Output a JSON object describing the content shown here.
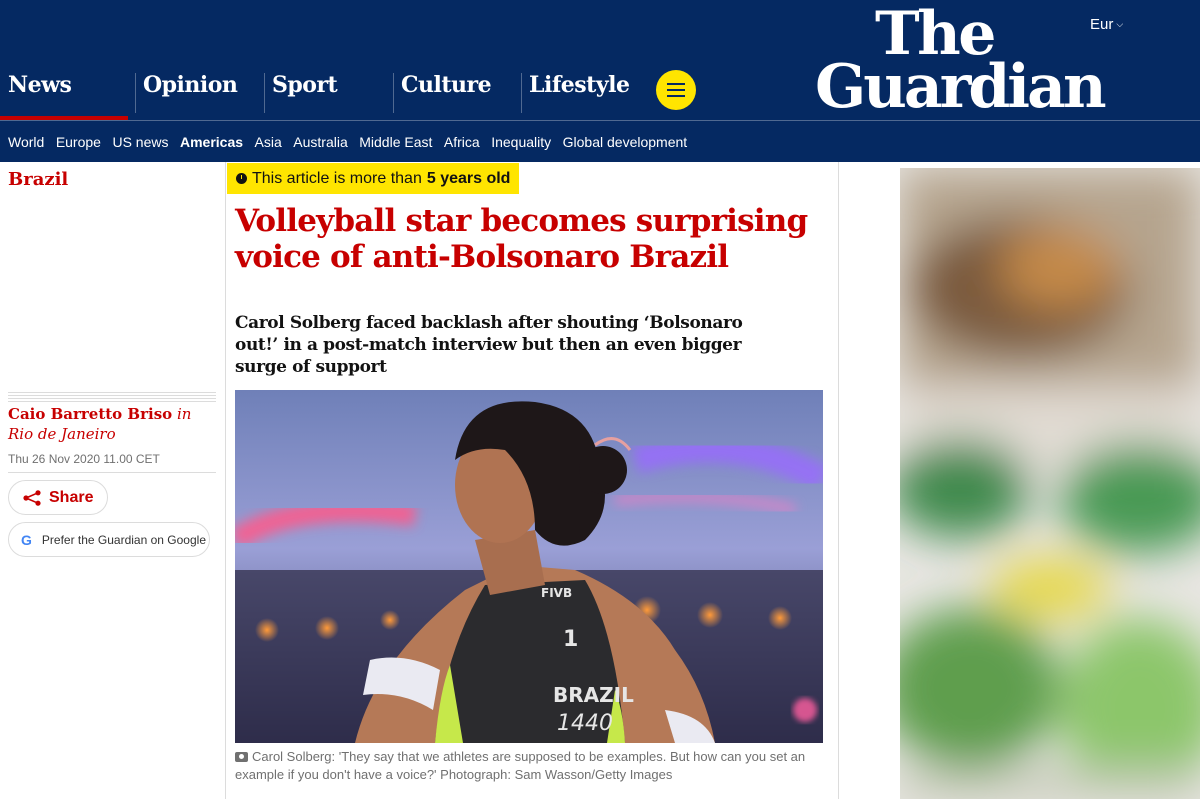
{
  "masthead": {
    "edition": "Eur",
    "logo_line1": "The",
    "logo_line2": "Guardian",
    "pillars": [
      {
        "label": "News",
        "active": true
      },
      {
        "label": "Opinion",
        "active": false
      },
      {
        "label": "Sport",
        "active": false
      },
      {
        "label": "Culture",
        "active": false
      },
      {
        "label": "Lifestyle",
        "active": false
      }
    ],
    "menu_icon": "hamburger-icon",
    "subnav": [
      "World",
      "Europe",
      "US news",
      "Americas",
      "Asia",
      "Australia",
      "Middle East",
      "Africa",
      "Inequality",
      "Global development"
    ],
    "subnav_current": "Americas"
  },
  "colors": {
    "brand_blue": "#052962",
    "news_red": "#c70000",
    "highlight_yellow": "#ffe500",
    "meta_grey": "#707070"
  },
  "article": {
    "section": "Brazil",
    "age_prefix": "This article is more than",
    "age_value": "5 years old",
    "headline": "Volleyball star becomes surprising voice of anti-Bolsonaro Brazil",
    "standfirst": "Carol Solberg faced backlash after shouting ‘Bolsonaro out!’ in a post-match interview but then an even bigger surge of support",
    "author": "Caio Barretto Briso",
    "location": "in Rio de Janeiro",
    "date": "Thu 26 Nov 2020 11.00 CET",
    "share_label": "Share",
    "share_icon": "share-icon",
    "google_label": "Prefer the Guardian on Google",
    "google_icon": "google-g-icon",
    "photo_texts": {
      "brand": "FIVB",
      "number": "1",
      "country": "BRAZIL",
      "team": "1440"
    },
    "caption": "Carol Solberg: 'They say that we athletes are supposed to be examples. But how can you set an example if you don't have a voice?' Photograph: Sam Wasson/Getty Images",
    "caption_icon": "camera-icon"
  }
}
